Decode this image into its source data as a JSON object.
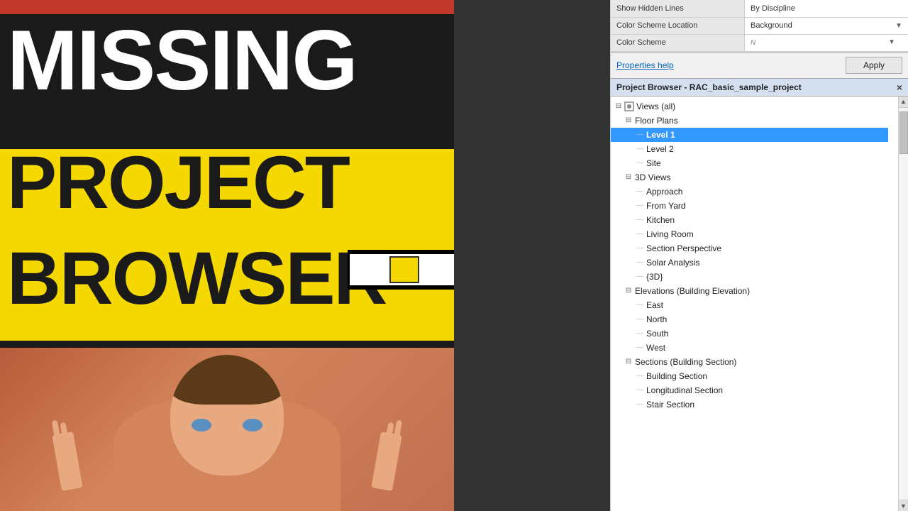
{
  "left": {
    "missing_label": "MISSING",
    "project_label": "PROJECT",
    "browser_label": "BROWSER"
  },
  "properties": {
    "rows": [
      {
        "label": "Show Hidden Lines",
        "value": "By Discipline"
      },
      {
        "label": "Color Scheme Location",
        "value": "Background"
      },
      {
        "label": "Color Scheme",
        "value": "N"
      }
    ],
    "help_link": "Properties help",
    "apply_label": "Apply"
  },
  "project_browser": {
    "title": "Project Browser - RAC_basic_sample_project",
    "close_icon": "×",
    "scroll_up": "▲",
    "scroll_down": "▼",
    "tree": {
      "root": {
        "label": "Views (all)",
        "icon": "⊟",
        "children": [
          {
            "label": "Floor Plans",
            "icon": "⊟",
            "children": [
              {
                "label": "Level 1",
                "selected": true
              },
              {
                "label": "Level 2"
              },
              {
                "label": "Site"
              }
            ]
          },
          {
            "label": "3D Views",
            "icon": "⊟",
            "children": [
              {
                "label": "Approach"
              },
              {
                "label": "From Yard"
              },
              {
                "label": "Kitchen"
              },
              {
                "label": "Living Room"
              },
              {
                "label": "Section Perspective"
              },
              {
                "label": "Solar Analysis"
              },
              {
                "label": "{3D}"
              }
            ]
          },
          {
            "label": "Elevations (Building Elevation)",
            "icon": "⊟",
            "children": [
              {
                "label": "East"
              },
              {
                "label": "North"
              },
              {
                "label": "South"
              },
              {
                "label": "West"
              }
            ]
          },
          {
            "label": "Sections (Building Section)",
            "icon": "⊟",
            "children": [
              {
                "label": "Building Section"
              },
              {
                "label": "Longitudinal Section"
              },
              {
                "label": "Stair Section"
              }
            ]
          }
        ]
      }
    }
  }
}
